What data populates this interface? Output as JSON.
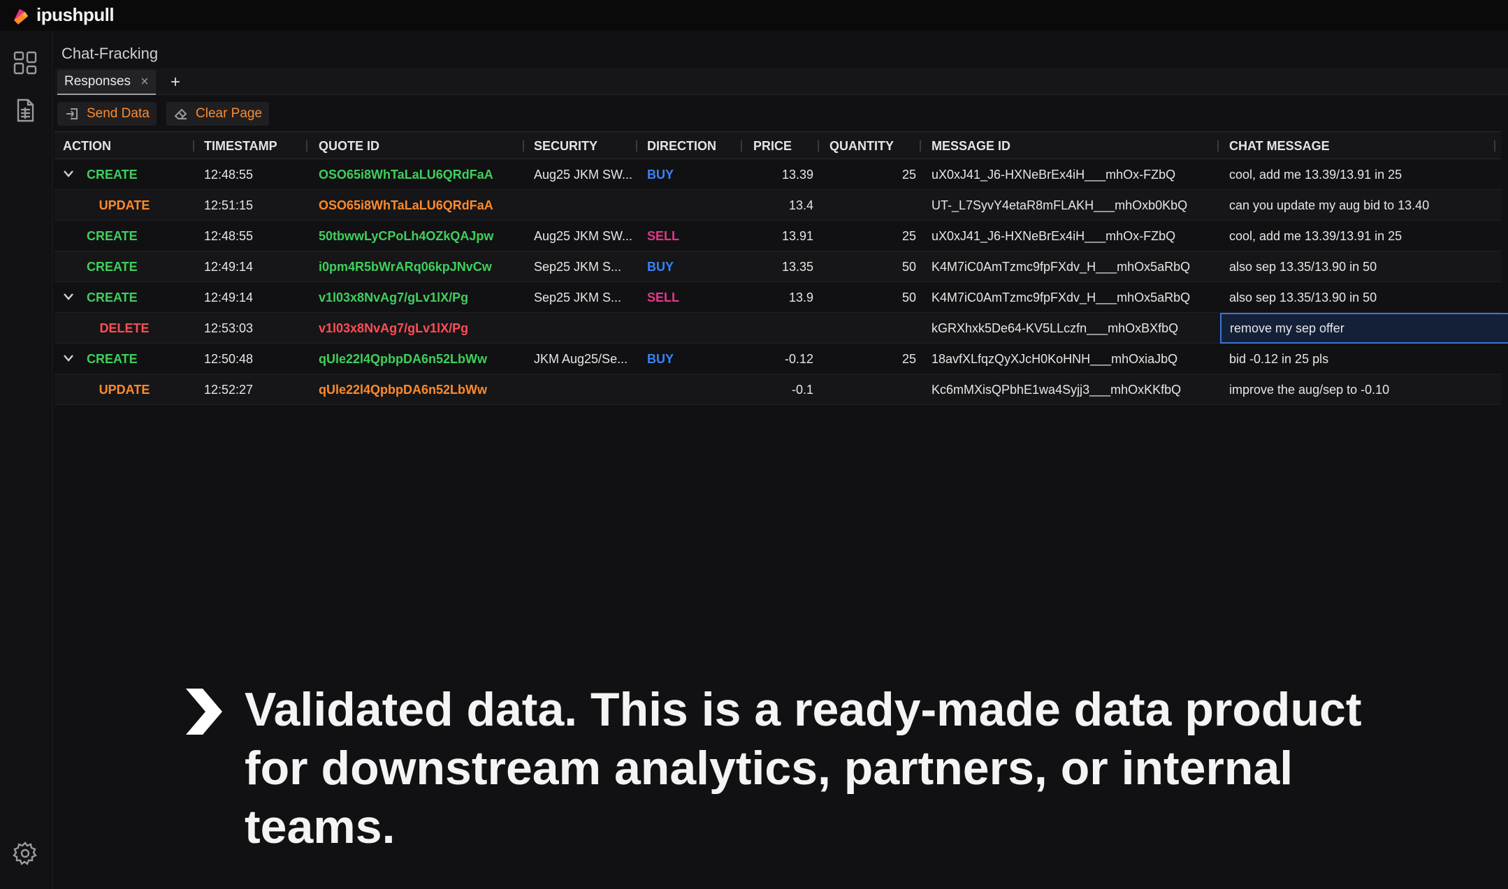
{
  "app": {
    "brand": "ipushpull",
    "colors": {
      "accent_orange": "#ff8a2a",
      "create_green": "#3fcf5c",
      "delete_red": "#ff4d55",
      "buy_blue": "#3b82f6",
      "sell_pink": "#e8358a"
    }
  },
  "sidebar": {
    "icons": [
      "dashboard-icon",
      "document-icon",
      "gear-icon"
    ]
  },
  "page": {
    "title": "Chat-Fracking"
  },
  "tabs": [
    {
      "label": "Responses",
      "close": "×"
    }
  ],
  "tab_add": "+",
  "toolbar": {
    "send_label": "Send Data",
    "clear_label": "Clear Page"
  },
  "grid": {
    "columns": [
      "ACTION",
      "TIMESTAMP",
      "QUOTE ID",
      "SECURITY",
      "DIRECTION",
      "PRICE",
      "QUANTITY",
      "MESSAGE ID",
      "CHAT MESSAGE"
    ],
    "rows": [
      {
        "expanded": true,
        "child": false,
        "action": "CREATE",
        "timestamp": "12:48:55",
        "quote_id": "OSO65i8WhTaLaLU6QRdFaA",
        "security": "Aug25 JKM SW...",
        "direction": "BUY",
        "price": "13.39",
        "quantity": "25",
        "message_id": "uX0xJ41_J6-HXNeBrEx4iH___mhOx-FZbQ",
        "chat_message": "cool, add me 13.39/13.91 in 25"
      },
      {
        "expanded": false,
        "child": true,
        "action": "UPDATE",
        "timestamp": "12:51:15",
        "quote_id": "OSO65i8WhTaLaLU6QRdFaA",
        "security": "",
        "direction": "",
        "price": "13.4",
        "quantity": "",
        "message_id": "UT-_L7SyvY4etaR8mFLAKH___mhOxb0KbQ",
        "chat_message": "can you update my aug bid to 13.40"
      },
      {
        "expanded": false,
        "child": false,
        "action": "CREATE",
        "timestamp": "12:48:55",
        "quote_id": "50tbwwLyCPoLh4OZkQAJpw",
        "security": "Aug25 JKM SW...",
        "direction": "SELL",
        "price": "13.91",
        "quantity": "25",
        "message_id": "uX0xJ41_J6-HXNeBrEx4iH___mhOx-FZbQ",
        "chat_message": "cool, add me 13.39/13.91 in 25"
      },
      {
        "expanded": false,
        "child": false,
        "action": "CREATE",
        "timestamp": "12:49:14",
        "quote_id": "i0pm4R5bWrARq06kpJNvCw",
        "security": "Sep25 JKM S...",
        "direction": "BUY",
        "price": "13.35",
        "quantity": "50",
        "message_id": "K4M7iC0AmTzmc9fpFXdv_H___mhOx5aRbQ",
        "chat_message": "also sep 13.35/13.90 in 50"
      },
      {
        "expanded": true,
        "child": false,
        "action": "CREATE",
        "timestamp": "12:49:14",
        "quote_id": "v1l03x8NvAg7/gLv1lX/Pg",
        "security": "Sep25 JKM S...",
        "direction": "SELL",
        "price": "13.9",
        "quantity": "50",
        "message_id": "K4M7iC0AmTzmc9fpFXdv_H___mhOx5aRbQ",
        "chat_message": "also sep 13.35/13.90 in 50"
      },
      {
        "expanded": false,
        "child": true,
        "action": "DELETE",
        "timestamp": "12:53:03",
        "quote_id": "v1l03x8NvAg7/gLv1lX/Pg",
        "security": "",
        "direction": "",
        "price": "",
        "quantity": "",
        "message_id": "kGRXhxk5De64-KV5LLczfn___mhOxBXfbQ",
        "chat_message": "remove my sep offer",
        "selected_chat": true
      },
      {
        "expanded": true,
        "child": false,
        "action": "CREATE",
        "timestamp": "12:50:48",
        "quote_id": "qUle22l4QpbpDA6n52LbWw",
        "security": "JKM Aug25/Se...",
        "direction": "BUY",
        "price": "-0.12",
        "quantity": "25",
        "message_id": "18avfXLfqzQyXJcH0KoHNH___mhOxiaJbQ",
        "chat_message": "bid -0.12 in 25 pls"
      },
      {
        "expanded": false,
        "child": true,
        "action": "UPDATE",
        "timestamp": "12:52:27",
        "quote_id": "qUle22l4QpbpDA6n52LbWw",
        "security": "",
        "direction": "",
        "price": "-0.1",
        "quantity": "",
        "message_id": "Kc6mMXisQPbhE1wa4Syjj3___mhOxKKfbQ",
        "chat_message": "improve the aug/sep to -0.10"
      }
    ]
  },
  "caption": {
    "text": "Validated data. This is a ready-made data product for downstream analytics, partners, or internal teams."
  }
}
